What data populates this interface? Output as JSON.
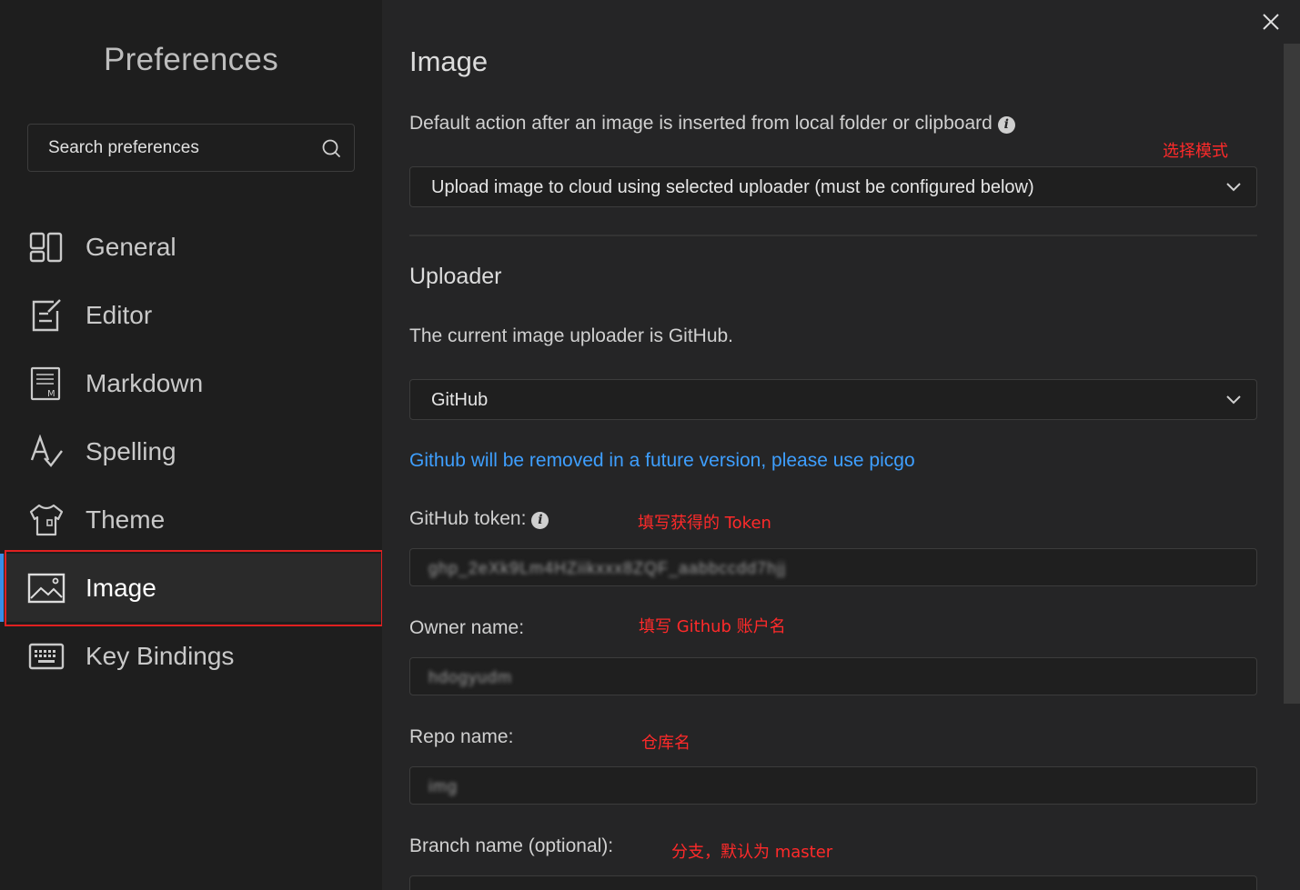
{
  "sidebar": {
    "title": "Preferences",
    "search_placeholder": "Search preferences",
    "items": [
      {
        "label": "General",
        "icon": "general-icon"
      },
      {
        "label": "Editor",
        "icon": "editor-icon"
      },
      {
        "label": "Markdown",
        "icon": "markdown-icon"
      },
      {
        "label": "Spelling",
        "icon": "spelling-icon"
      },
      {
        "label": "Theme",
        "icon": "theme-icon"
      },
      {
        "label": "Image",
        "icon": "image-icon",
        "active": true
      },
      {
        "label": "Key Bindings",
        "icon": "keyboard-icon"
      }
    ]
  },
  "main": {
    "title": "Image",
    "default_action_label": "Default action after an image is inserted from local folder or clipboard",
    "default_action_value": "Upload image to cloud using selected uploader (must be configured below)",
    "uploader_heading": "Uploader",
    "uploader_status": "The current image uploader is GitHub.",
    "uploader_value": "GitHub",
    "deprecation_link": "Github will be removed in a future version, please use picgo",
    "token_label": "GitHub token:",
    "token_value": "ghp_2eXk9Lm4HZiikxxx8ZQF_aabbccdd7hjj",
    "owner_label": "Owner name:",
    "owner_value": "hdogyudm",
    "repo_label": "Repo name:",
    "repo_value": "img",
    "branch_label": "Branch name (optional):"
  },
  "annotations": {
    "select_mode": "选择模式",
    "fill_token": "填写获得的 Token",
    "fill_owner": "填写 Github 账户名",
    "repo": "仓库名",
    "branch": "分支，默认为 master"
  },
  "colors": {
    "accent": "#3a8ee6",
    "link": "#3e9fff",
    "annotation": "#ff2a2a"
  }
}
